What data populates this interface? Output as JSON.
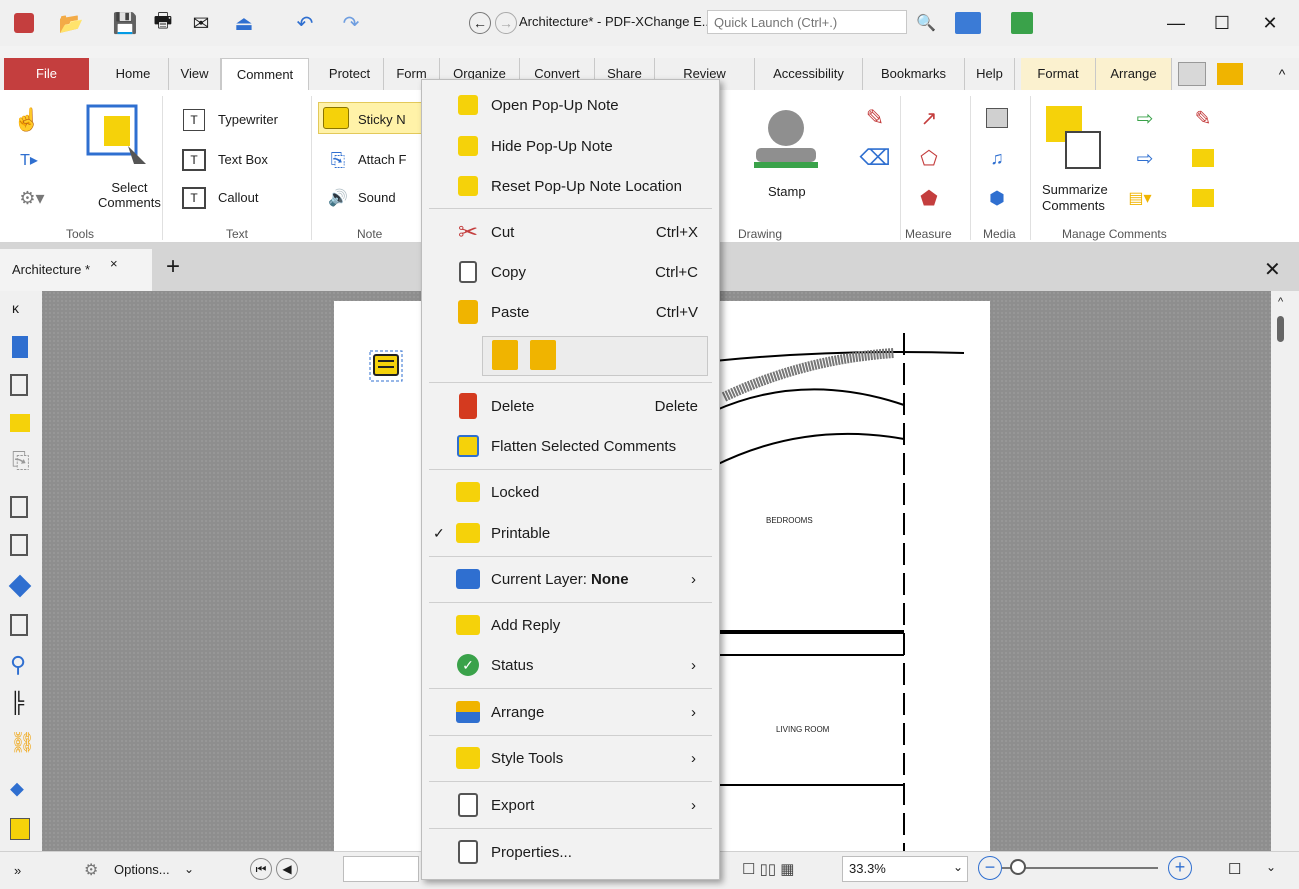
{
  "window": {
    "title": "Architecture* - PDF-XChange E..",
    "quick_launch_placeholder": "Quick Launch (Ctrl+.)",
    "minimize": "—",
    "maximize": "☐",
    "close": "✕"
  },
  "ribbon_tabs": [
    "File",
    "Home",
    "View",
    "Comment",
    "Protect",
    "Form",
    "Organize",
    "Convert",
    "Share",
    "Review",
    "Accessibility",
    "Bookmarks",
    "Help",
    "Format",
    "Arrange"
  ],
  "ribbon": {
    "select_comments": "Select\nComments",
    "typewriter": "Typewriter",
    "text_box": "Text Box",
    "callout": "Callout",
    "sticky_note": "Sticky N",
    "attach": "Attach F",
    "sound": "Sound",
    "stamp": "Stamp",
    "summarize": "Summarize",
    "comments": "Comments",
    "groups": {
      "tools": "Tools",
      "text": "Text",
      "note": "Note",
      "drawing": "Drawing",
      "measure": "Measure",
      "media": "Media",
      "manage": "Manage Comments"
    }
  },
  "document_tab": {
    "label": "Architecture *",
    "close": "×",
    "add": "+"
  },
  "document": {
    "bedrooms": "BEDROOMS",
    "living_room": "LIVING ROOM"
  },
  "context_menu": [
    {
      "id": "open-popup",
      "label": "Open Pop-Up Note",
      "shortcut": "",
      "submenu": false,
      "checked": false,
      "bold_suffix": ""
    },
    {
      "id": "hide-popup",
      "label": "Hide Pop-Up Note",
      "shortcut": "",
      "submenu": false,
      "checked": false,
      "bold_suffix": ""
    },
    {
      "id": "reset-popup",
      "label": "Reset Pop-Up Note Location",
      "shortcut": "",
      "submenu": false,
      "checked": false,
      "bold_suffix": ""
    },
    {
      "id": "cut",
      "label": "Cut",
      "shortcut": "Ctrl+X"
    },
    {
      "id": "copy",
      "label": "Copy",
      "shortcut": "Ctrl+C"
    },
    {
      "id": "paste",
      "label": "Paste",
      "shortcut": "Ctrl+V"
    },
    {
      "id": "delete",
      "label": "Delete",
      "shortcut": "Delete"
    },
    {
      "id": "flatten",
      "label": "Flatten Selected Comments",
      "shortcut": ""
    },
    {
      "id": "locked",
      "label": "Locked",
      "shortcut": ""
    },
    {
      "id": "printable",
      "label": "Printable",
      "shortcut": "",
      "checked": true
    },
    {
      "id": "current-layer",
      "label": "Current Layer:",
      "bold_suffix": "None",
      "submenu": true
    },
    {
      "id": "add-reply",
      "label": "Add Reply",
      "shortcut": ""
    },
    {
      "id": "status",
      "label": "Status",
      "submenu": true
    },
    {
      "id": "arrange",
      "label": "Arrange",
      "submenu": true
    },
    {
      "id": "style-tools",
      "label": "Style Tools",
      "submenu": true
    },
    {
      "id": "export",
      "label": "Export",
      "submenu": true
    },
    {
      "id": "properties",
      "label": "Properties...",
      "shortcut": ""
    }
  ],
  "bottom": {
    "options": "Options...",
    "zoom": "33.3%"
  },
  "colors": {
    "file_tab": "#c43e3e",
    "accent_yellow": "#f5d20a",
    "accent_blue": "#2f6fd0"
  }
}
